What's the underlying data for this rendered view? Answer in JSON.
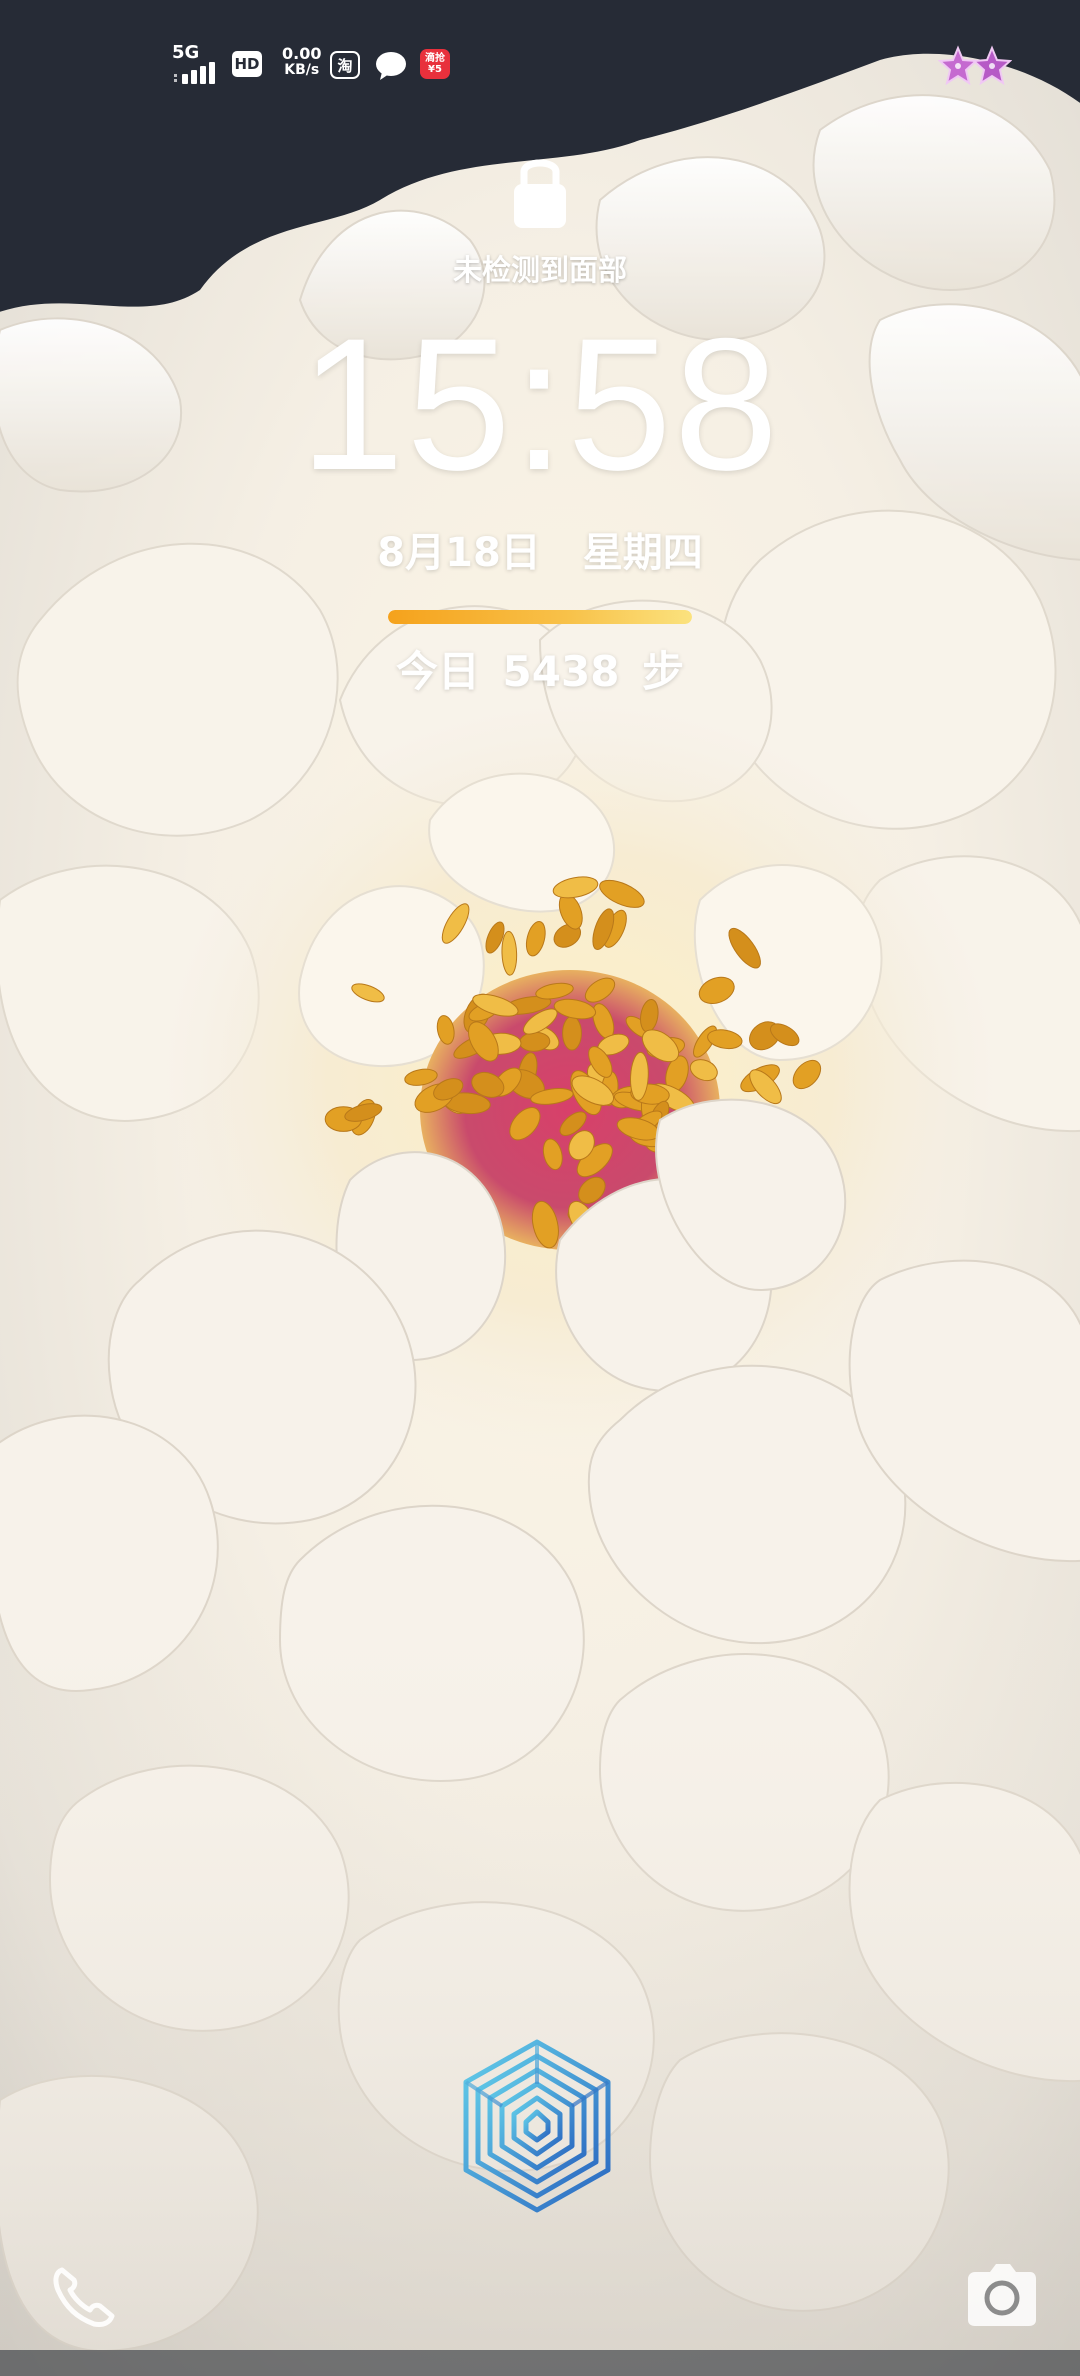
{
  "status_bar": {
    "network": "5G",
    "hd": "HD",
    "speed_value": "0.00",
    "speed_unit": "KB/s",
    "taobao_icon_char": "淘",
    "app_icon_text": "滴抢 ¥5"
  },
  "lock_screen": {
    "face_status": "未检测到面部",
    "time": "15:58",
    "date": "8月18日",
    "weekday": "星期四",
    "steps_prefix": "今日",
    "steps_count": "5438",
    "steps_unit": "步",
    "steps_progress": 1.0
  },
  "colors": {
    "accent_orange": "#f5a21c",
    "accent_yellow": "#fbe27e",
    "background_dark": "#262b36",
    "petal_white": "#f4efe6",
    "stamen_gold": "#e2a024",
    "fingerprint_blue": "#3fa0d8"
  },
  "icons": {
    "lock": "lock-icon",
    "fingerprint": "fingerprint-icon",
    "phone": "phone-icon",
    "camera": "camera-icon",
    "message": "message-bubble-icon",
    "signal": "signal-bars-icon",
    "stars": "star-sticker-icon"
  }
}
